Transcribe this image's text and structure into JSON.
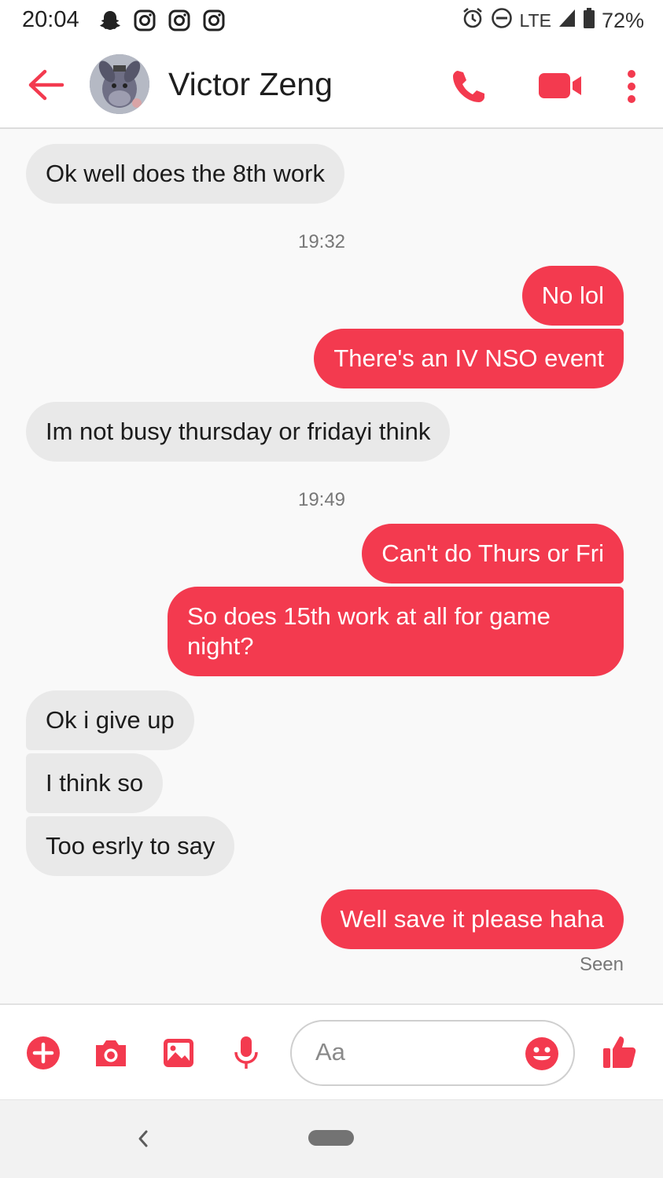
{
  "status_bar": {
    "time": "20:04",
    "network": "LTE",
    "battery": "72%",
    "icons": [
      "snapchat-icon",
      "instagram-icon",
      "instagram-icon",
      "instagram-icon",
      "alarm-icon",
      "do-not-disturb-icon",
      "signal-icon",
      "battery-icon"
    ]
  },
  "header": {
    "contact_name": "Victor Zeng",
    "icons": [
      "back-arrow-icon",
      "avatar",
      "phone-icon",
      "video-camera-icon",
      "more-vert-icon"
    ]
  },
  "conversation": {
    "messages": [
      {
        "direction": "in",
        "text": "Ok well does the 8th work"
      },
      {
        "type": "timestamp",
        "text": "19:32"
      },
      {
        "direction": "out",
        "text": "No lol"
      },
      {
        "direction": "out",
        "text": "There's an IV NSO event"
      },
      {
        "direction": "in",
        "text": "Im not busy thursday or fridayi think"
      },
      {
        "type": "timestamp",
        "text": "19:49"
      },
      {
        "direction": "out",
        "text": "Can't do Thurs or Fri"
      },
      {
        "direction": "out",
        "text": "So does 15th work at all for game night?"
      },
      {
        "direction": "in",
        "text": "Ok i give up"
      },
      {
        "direction": "in",
        "text": "I think so"
      },
      {
        "direction": "in",
        "text": "Too esrly to say"
      },
      {
        "direction": "out",
        "text": "Well save it please haha"
      }
    ],
    "seen": "Seen"
  },
  "composer": {
    "placeholder": "Aa",
    "icons": [
      "add-circle-icon",
      "camera-icon",
      "gallery-icon",
      "microphone-icon",
      "emoji-icon",
      "thumbs-up-icon"
    ]
  },
  "colors": {
    "accent": "#f33a4f",
    "incoming_bubble": "#e9e9e9",
    "conversation_bg": "#f9f9f9"
  }
}
